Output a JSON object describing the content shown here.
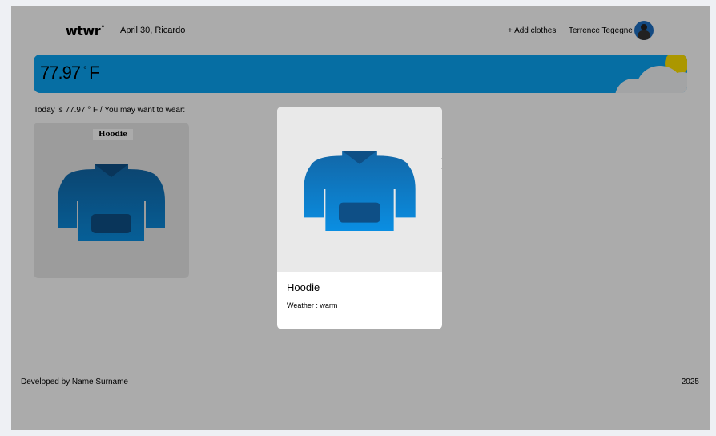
{
  "header": {
    "logo_text": "wtwr",
    "logo_mark": "°",
    "date_location": "April 30, Ricardo",
    "add_clothes_label": "+ Add clothes",
    "user_name": "Terrence Tegegne",
    "avatar_icon": "user-avatar"
  },
  "weather": {
    "temp_value": "77.97",
    "temp_degree": "°",
    "temp_unit": "F",
    "condition_icons": [
      "sun-icon",
      "cloud-icon"
    ],
    "colors": {
      "card_bg": "#0aa4f4",
      "sun": "#ffe100",
      "cloud": "#f4f5f6"
    }
  },
  "main": {
    "recommendation_text": "Today is 77.97 ° F / You may want to wear:",
    "items": [
      {
        "name": "Hoodie",
        "icon": "hoodie-icon"
      }
    ]
  },
  "modal": {
    "title": "Hoodie",
    "weather_text": "Weather : warm",
    "image_icon": "hoodie-icon",
    "close_icon": "close-icon"
  },
  "footer": {
    "developer_text": "Developed by Name Surname",
    "year": "2025"
  },
  "colors": {
    "hoodie_top": "#1266a6",
    "hoodie_bottom": "#0a8ee2",
    "overlay": "rgba(0,0,0,0.33)"
  }
}
